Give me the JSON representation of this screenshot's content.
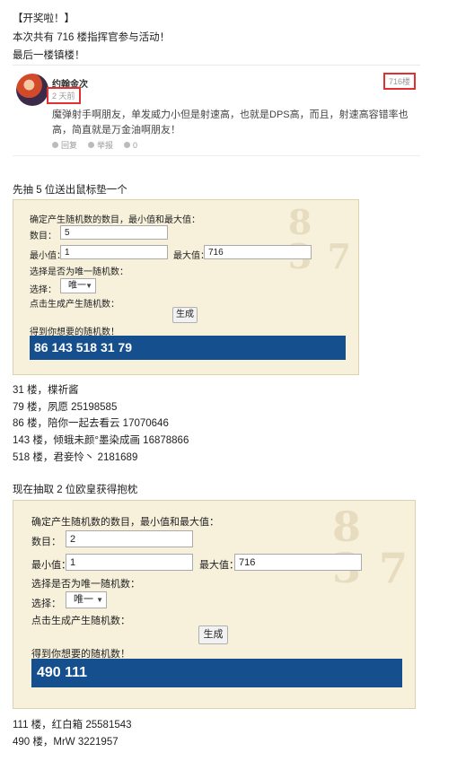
{
  "intro": {
    "title": "【开奖啦！】",
    "line1": "本次共有 716 楼指挥官参与活动！",
    "line2": "最后一楼镇楼！"
  },
  "comment": {
    "username": "约翰金次",
    "time_ago": "2 天前",
    "floor": "716楼",
    "text": "魔弹射手啊朋友，单发威力小但是射速高，也就是DPS高，而且，射速高容错率也高，简直就是万金油啊朋友！",
    "reply": "回复",
    "report": "举报",
    "like": "0"
  },
  "section1": {
    "heading": "先抽 5 位送出鼠标垫一个",
    "panel": {
      "intro": "确定产生随机数的数目，最小值和最大值：",
      "count_label": "数目：",
      "count_value": "5",
      "min_label": "最小值：",
      "min_value": "1",
      "max_label": "最大值：",
      "max_value": "716",
      "unique_prompt": "选择是否为唯一随机数：",
      "select_label": "选择：",
      "select_value": "唯一",
      "generate_prompt": "点击生成产生随机数：",
      "generate_button": "生成",
      "result_label": "得到你想要的随机数！",
      "result": "86  143  518  31  79"
    },
    "winners": [
      "31 楼，楪祈酱",
      "79 楼，夙愿  25198585",
      "86 楼，陪你一起去看云 17070646",
      "143 楼，倾蛾未颜°墨染成画 16878866",
      "518 楼，君妾怜丶  2181689"
    ]
  },
  "section2": {
    "heading": "现在抽取 2 位欧皇获得抱枕",
    "panel": {
      "intro": "确定产生随机数的数目，最小值和最大值：",
      "count_label": "数目：",
      "count_value": "2",
      "min_label": "最小值：",
      "min_value": "1",
      "max_label": "最大值：",
      "max_value": "716",
      "unique_prompt": "选择是否为唯一随机数：",
      "select_label": "选择：",
      "select_value": "唯一",
      "generate_prompt": "点击生成产生随机数：",
      "generate_button": "生成",
      "result_label": "得到你想要的随机数！",
      "result": "490  111"
    },
    "winners": [
      "111 楼，红白箱 25581543",
      "490 楼，MrW 3221957"
    ]
  },
  "colors": {
    "highlight_border": "#e03030",
    "panel_bg": "#f7f1dc",
    "result_bg": "#154f8e"
  }
}
